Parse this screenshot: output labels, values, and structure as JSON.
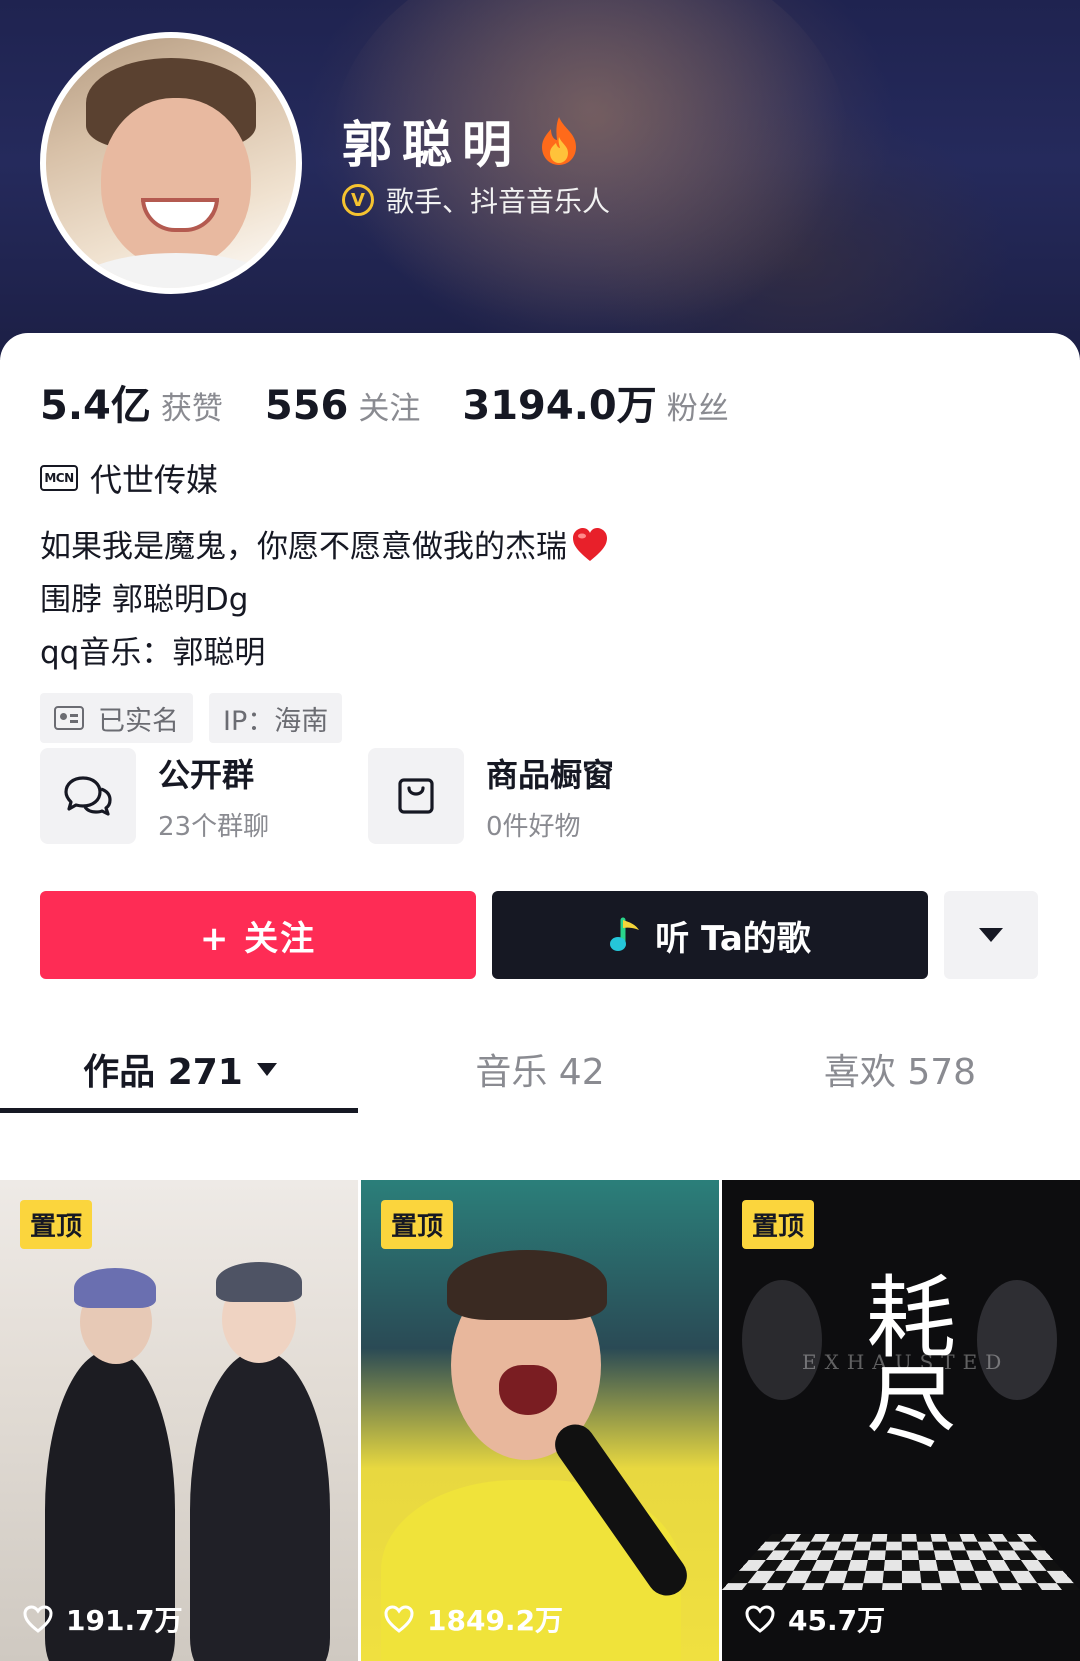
{
  "profile": {
    "nickname": "郭聪明",
    "verification": "歌手、抖音音乐人",
    "mcn": "代世传媒",
    "bio_lines": [
      "如果我是魔鬼，你愿不愿意做我的杰瑞",
      "围脖 郭聪明Dg",
      "qq音乐：郭聪明"
    ],
    "tags": [
      "已实名",
      "IP：海南"
    ]
  },
  "stats": [
    {
      "value": "5.4亿",
      "label": "获赞"
    },
    {
      "value": "556",
      "label": "关注"
    },
    {
      "value": "3194.0万",
      "label": "粉丝"
    }
  ],
  "entries": [
    {
      "title": "公开群",
      "subtitle": "23个群聊",
      "icon": "chat-bubbles-icon"
    },
    {
      "title": "商品橱窗",
      "subtitle": "0件好物",
      "icon": "shopping-bag-icon"
    }
  ],
  "actions": {
    "follow_label": "+ 关注",
    "listen_label": "听 Ta的歌"
  },
  "tabs": [
    {
      "label": "作品 271",
      "active": true
    },
    {
      "label": "音乐 42",
      "active": false
    },
    {
      "label": "喜欢 578",
      "active": false
    }
  ],
  "videos": [
    {
      "badge": "置顶",
      "likes": "191.7万"
    },
    {
      "badge": "置顶",
      "likes": "1849.2万"
    },
    {
      "badge": "置顶",
      "likes": "45.7万",
      "title_glyph": "耗尽",
      "subtitle": "EXHAUSTED"
    }
  ],
  "colors": {
    "follow_red": "#fe2c55",
    "listen_dark": "#161823",
    "badge_yellow": "#fbd53d",
    "verified_gold": "#f5c330"
  }
}
